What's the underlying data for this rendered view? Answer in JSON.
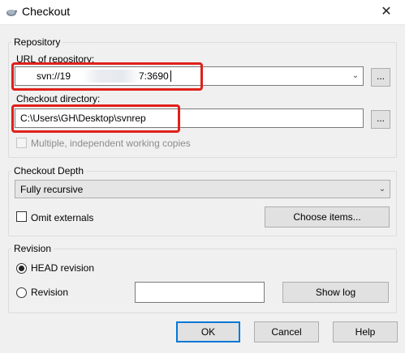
{
  "window": {
    "title": "Checkout",
    "close_glyph": "✕"
  },
  "repository": {
    "group_label": "Repository",
    "url_label": "URL of repository:",
    "url_value_prefix": "svn://19",
    "url_value_suffix": "7:3690",
    "browse_label": "...",
    "dir_label": "Checkout directory:",
    "dir_value": "C:\\Users\\GH\\Desktop\\svnrep",
    "dir_browse_label": "...",
    "multiple_label": "Multiple, independent working copies"
  },
  "depth": {
    "group_label": "Checkout Depth",
    "selected": "Fully recursive",
    "omit_externals_label": "Omit externals",
    "choose_items_label": "Choose items..."
  },
  "revision": {
    "group_label": "Revision",
    "head_label": "HEAD revision",
    "revision_label": "Revision",
    "revision_value": "",
    "show_log_label": "Show log"
  },
  "footer": {
    "ok_label": "OK",
    "cancel_label": "Cancel",
    "help_label": "Help"
  },
  "icons": {
    "app": "tortoise-icon",
    "dropdown": "chevron-down-icon"
  },
  "colors": {
    "highlight": "#e0201a",
    "focus": "#0078d7"
  }
}
